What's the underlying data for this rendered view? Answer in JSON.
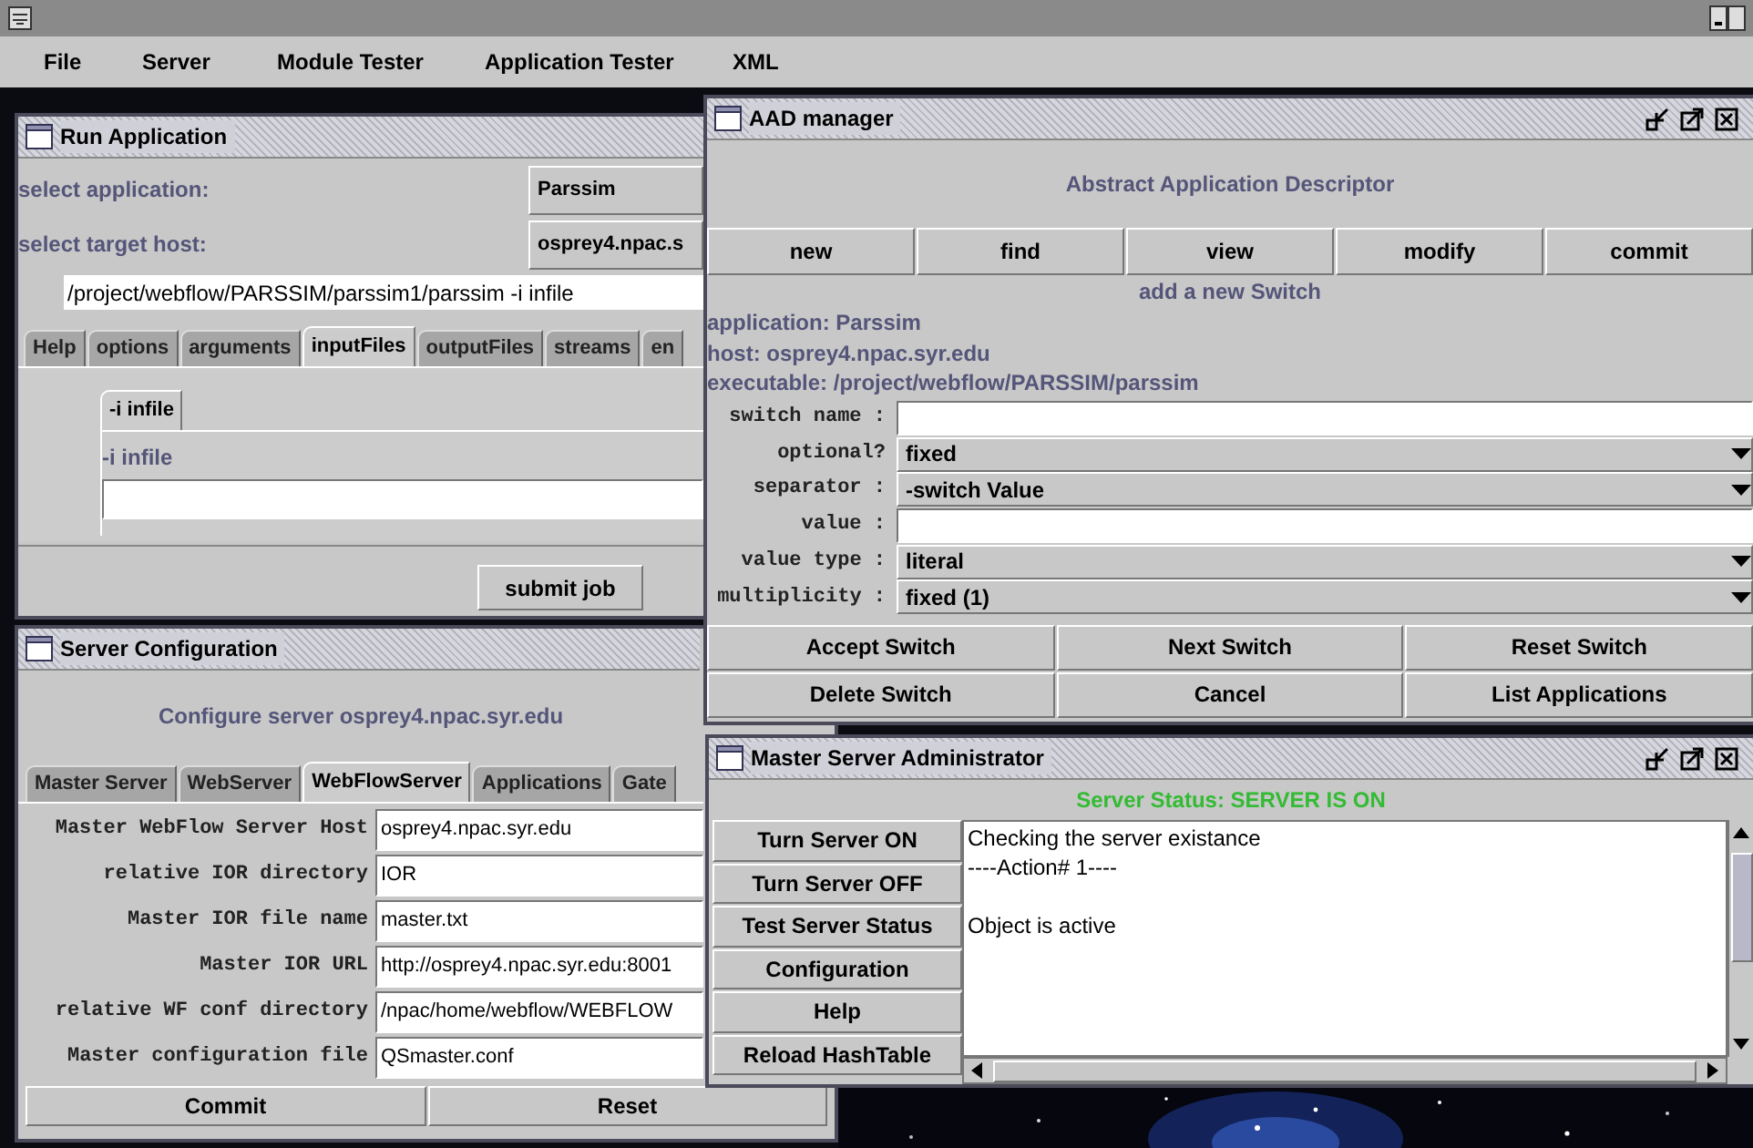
{
  "menu": [
    "File",
    "Server",
    "Module Tester",
    "Application Tester",
    "XML"
  ],
  "run_application": {
    "title": "Run Application",
    "fields": [
      {
        "label": "select application:",
        "value": "Parssim"
      },
      {
        "label": "select target host:",
        "value": "osprey4.npac.s"
      }
    ],
    "command": "/project/webflow/PARSSIM/parssim1/parssim -i infile",
    "tabs": [
      {
        "label": "Help",
        "selected": false
      },
      {
        "label": "options",
        "selected": false
      },
      {
        "label": "arguments",
        "selected": false
      },
      {
        "label": "inputFiles",
        "selected": true
      },
      {
        "label": "outputFiles",
        "selected": false
      },
      {
        "label": "streams",
        "selected": false
      },
      {
        "label": "en",
        "selected": false
      }
    ],
    "inner_tabs": [
      {
        "label": "-i infile",
        "selected": true
      }
    ],
    "input_label": "-i infile",
    "submit": "submit job"
  },
  "server_configuration": {
    "title": "Server Configuration",
    "heading": "Configure server osprey4.npac.syr.edu",
    "tabs": [
      {
        "label": "Master Server",
        "selected": false
      },
      {
        "label": "WebServer",
        "selected": false
      },
      {
        "label": "WebFlowServer",
        "selected": true
      },
      {
        "label": "Applications",
        "selected": false
      },
      {
        "label": "Gate",
        "selected": false
      }
    ],
    "fields": [
      {
        "label": "Master WebFlow Server Host",
        "value": "osprey4.npac.syr.edu"
      },
      {
        "label": "relative IOR directory",
        "value": "IOR"
      },
      {
        "label": "Master IOR file name",
        "value": "master.txt"
      },
      {
        "label": "Master IOR URL",
        "value": "http://osprey4.npac.syr.edu:8001"
      },
      {
        "label": "relative WF conf directory",
        "value": "/npac/home/webflow/WEBFLOW"
      },
      {
        "label": "Master configuration file",
        "value": "QSmaster.conf"
      }
    ],
    "buttons": [
      "Commit",
      "Reset"
    ]
  },
  "aad_manager": {
    "title": "AAD manager",
    "heading": "Abstract Application Descriptor",
    "toolbar": [
      "new",
      "find",
      "view",
      "modify",
      "commit"
    ],
    "subheading": "add a new Switch",
    "info": [
      "application: Parssim",
      "host: osprey4.npac.syr.edu",
      "executable: /project/webflow/PARSSIM/parssim"
    ],
    "form": [
      {
        "label": "switch name :",
        "kind": "text"
      },
      {
        "label": "optional?",
        "kind": "select",
        "value": "fixed"
      },
      {
        "label": "separator :",
        "kind": "select",
        "value": "-switch Value"
      },
      {
        "label": "value :",
        "kind": "text"
      },
      {
        "label": "value type :",
        "kind": "select",
        "value": "literal"
      },
      {
        "label": "multiplicity :",
        "kind": "select",
        "value": "fixed (1)"
      }
    ],
    "buttons": [
      "Accept Switch",
      "Next Switch",
      "Reset Switch",
      "Delete Switch",
      "Cancel",
      "List Applications"
    ]
  },
  "master_server_administrator": {
    "title": "Master Server Administrator",
    "status": "Server Status: SERVER IS ON",
    "server_on": true,
    "actions": [
      "Turn Server ON",
      "Turn Server OFF",
      "Test Server Status",
      "Configuration",
      "Help",
      "Reload HashTable"
    ],
    "log": "Checking the server existance\n----Action# 1----\n\nObject is active"
  }
}
